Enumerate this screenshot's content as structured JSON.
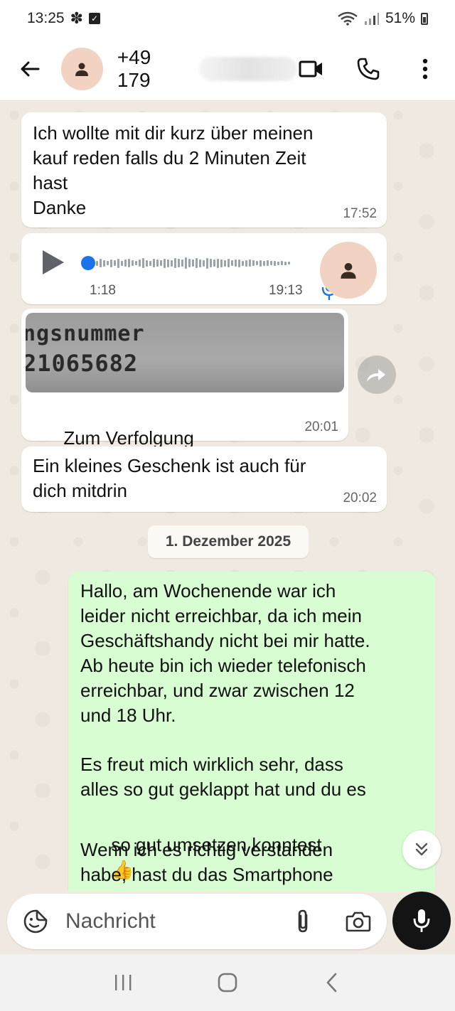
{
  "status_bar": {
    "time": "13:25",
    "battery": "51%",
    "icons": [
      "flower-icon",
      "check-box-icon",
      "wifi-icon",
      "signal-icon",
      "battery-icon"
    ]
  },
  "header": {
    "contact_number": "+49 179",
    "icons": [
      "back-arrow-icon",
      "avatar-icon",
      "video-call-icon",
      "phone-icon",
      "more-vert-icon"
    ]
  },
  "messages": [
    {
      "type": "text",
      "direction": "in",
      "text": "Ich wollte mit dir kurz über meinen\nkauf reden falls du 2 Minuten Zeit\nhast\nDanke",
      "time": "17:52"
    },
    {
      "type": "voice",
      "direction": "in",
      "duration": "1:18",
      "time": "19:13",
      "played_fraction": 0.0
    },
    {
      "type": "image",
      "direction": "in",
      "image_text_line1": "ngsnummer",
      "image_text_line2": "21065682",
      "caption": "Zum Verfolgung",
      "emoji": "🙋🏻‍♂️",
      "time": "20:01"
    },
    {
      "type": "text",
      "direction": "in",
      "text": "Ein kleines Geschenk ist auch für\ndich mitdrin",
      "time": "20:02"
    }
  ],
  "date_divider": "1. Dezember 2025",
  "outgoing_message": {
    "paragraph1": "Hallo, am Wochenende war ich\nleider nicht erreichbar, da ich mein\nGeschäftshandy nicht bei mir hatte.\nAb heute bin ich wieder telefonisch\nerreichbar, und zwar zwischen 12\nund 18 Uhr.",
    "paragraph2_line": "Es freut mich wirklich sehr, dass\nalles so gut geklappt hat und du es",
    "paragraph2_emoji_line": "so gut umsetzen konntest",
    "thumbs_emoji": "👍",
    "paragraph3": "Wenn ich es richtig verstanden\nhabe, hast du das Smartphone"
  },
  "composer": {
    "placeholder": "Nachricht",
    "icons": [
      "sticker-icon",
      "attach-icon",
      "camera-icon",
      "mic-icon"
    ]
  },
  "colors": {
    "chat_background": "#efe9e1",
    "incoming_bubble": "#ffffff",
    "outgoing_bubble": "#d9fdd3",
    "voice_progress": "#1a73e8",
    "mic_button": "#141414"
  }
}
